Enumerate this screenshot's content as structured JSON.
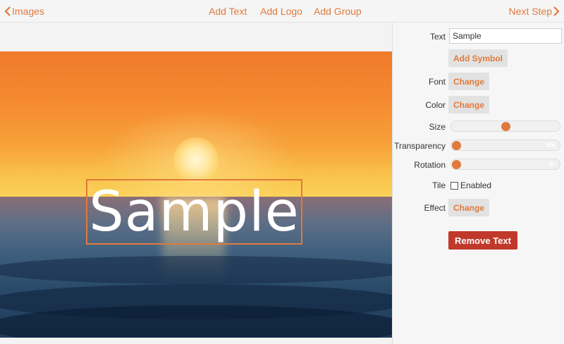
{
  "nav": {
    "back_label": "Images",
    "next_label": "Next Step",
    "add_text": "Add Text",
    "add_logo": "Add Logo",
    "add_group": "Add Group"
  },
  "canvas": {
    "overlay_text": "Sample"
  },
  "panel": {
    "text_label": "Text",
    "text_value": "Sample",
    "add_symbol": "Add Symbol",
    "font_label": "Font",
    "font_button": "Change",
    "color_label": "Color",
    "color_button": "Change",
    "size_label": "Size",
    "size_fraction": 0.5,
    "transparency_label": "Transparency",
    "transparency_value": "0%",
    "rotation_label": "Rotation",
    "rotation_value": "0°",
    "tile_label": "Tile",
    "tile_option": "Enabled",
    "tile_enabled": false,
    "effect_label": "Effect",
    "effect_button": "Change",
    "remove_text": "Remove Text"
  },
  "colors": {
    "accent": "#e07a3c",
    "danger": "#c0392b"
  },
  "icons": [
    "chevron-left-icon",
    "chevron-right-icon",
    "checkbox-icon"
  ]
}
